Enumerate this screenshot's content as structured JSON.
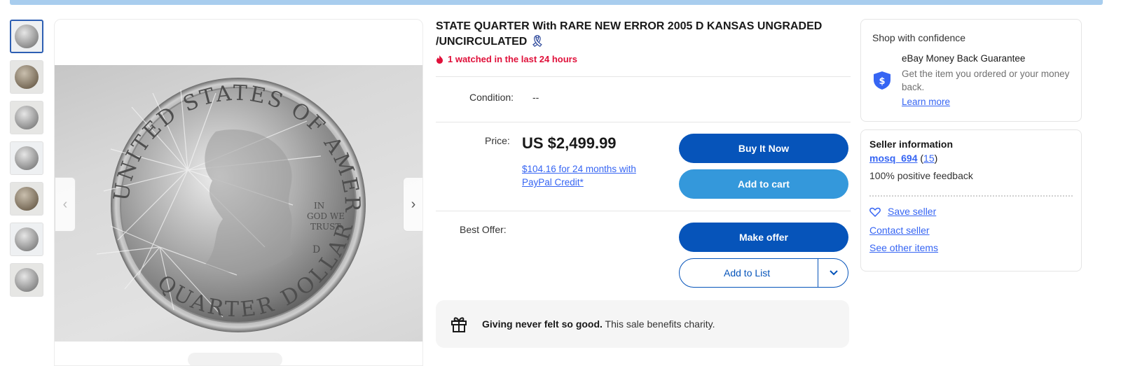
{
  "listing": {
    "title": "STATE QUARTER With RARE NEW ERROR 2005 D KANSAS UNGRADED /UNCIRCULATED",
    "watched": "1 watched in the last 24 hours",
    "condition_label": "Condition:",
    "condition_value": "--",
    "price_label": "Price:",
    "price": "US $2,499.99",
    "credit_line1": "$104.16 for 24 months with",
    "credit_line2": "PayPal Credit*",
    "best_offer_label": "Best Offer:",
    "charity_bold": "Giving never felt so good.",
    "charity_text": " This sale benefits charity."
  },
  "buttons": {
    "buy_now": "Buy It Now",
    "add_to_cart": "Add to cart",
    "make_offer": "Make offer",
    "add_to_list": "Add to List"
  },
  "coin_text": {
    "top": "UNITED STATES OF AMERICA",
    "bottom": "QUARTER DOLLAR",
    "motto1": "IN",
    "motto2": "GOD WE",
    "motto3": "TRUST",
    "mint": "D"
  },
  "confidence": {
    "title": "Shop with confidence",
    "headline": "eBay Money Back Guarantee",
    "body": "Get the item you ordered or your money back.",
    "link": "Learn more"
  },
  "seller": {
    "title": "Seller information",
    "name": "mosq_694",
    "count": "15",
    "feedback": "100% positive feedback",
    "save": "Save seller",
    "contact": "Contact seller",
    "other": "See other items"
  },
  "colors": {
    "primary": "#0654ba",
    "secondary": "#3498db",
    "link": "#3665f3",
    "alert": "#e0103a"
  }
}
